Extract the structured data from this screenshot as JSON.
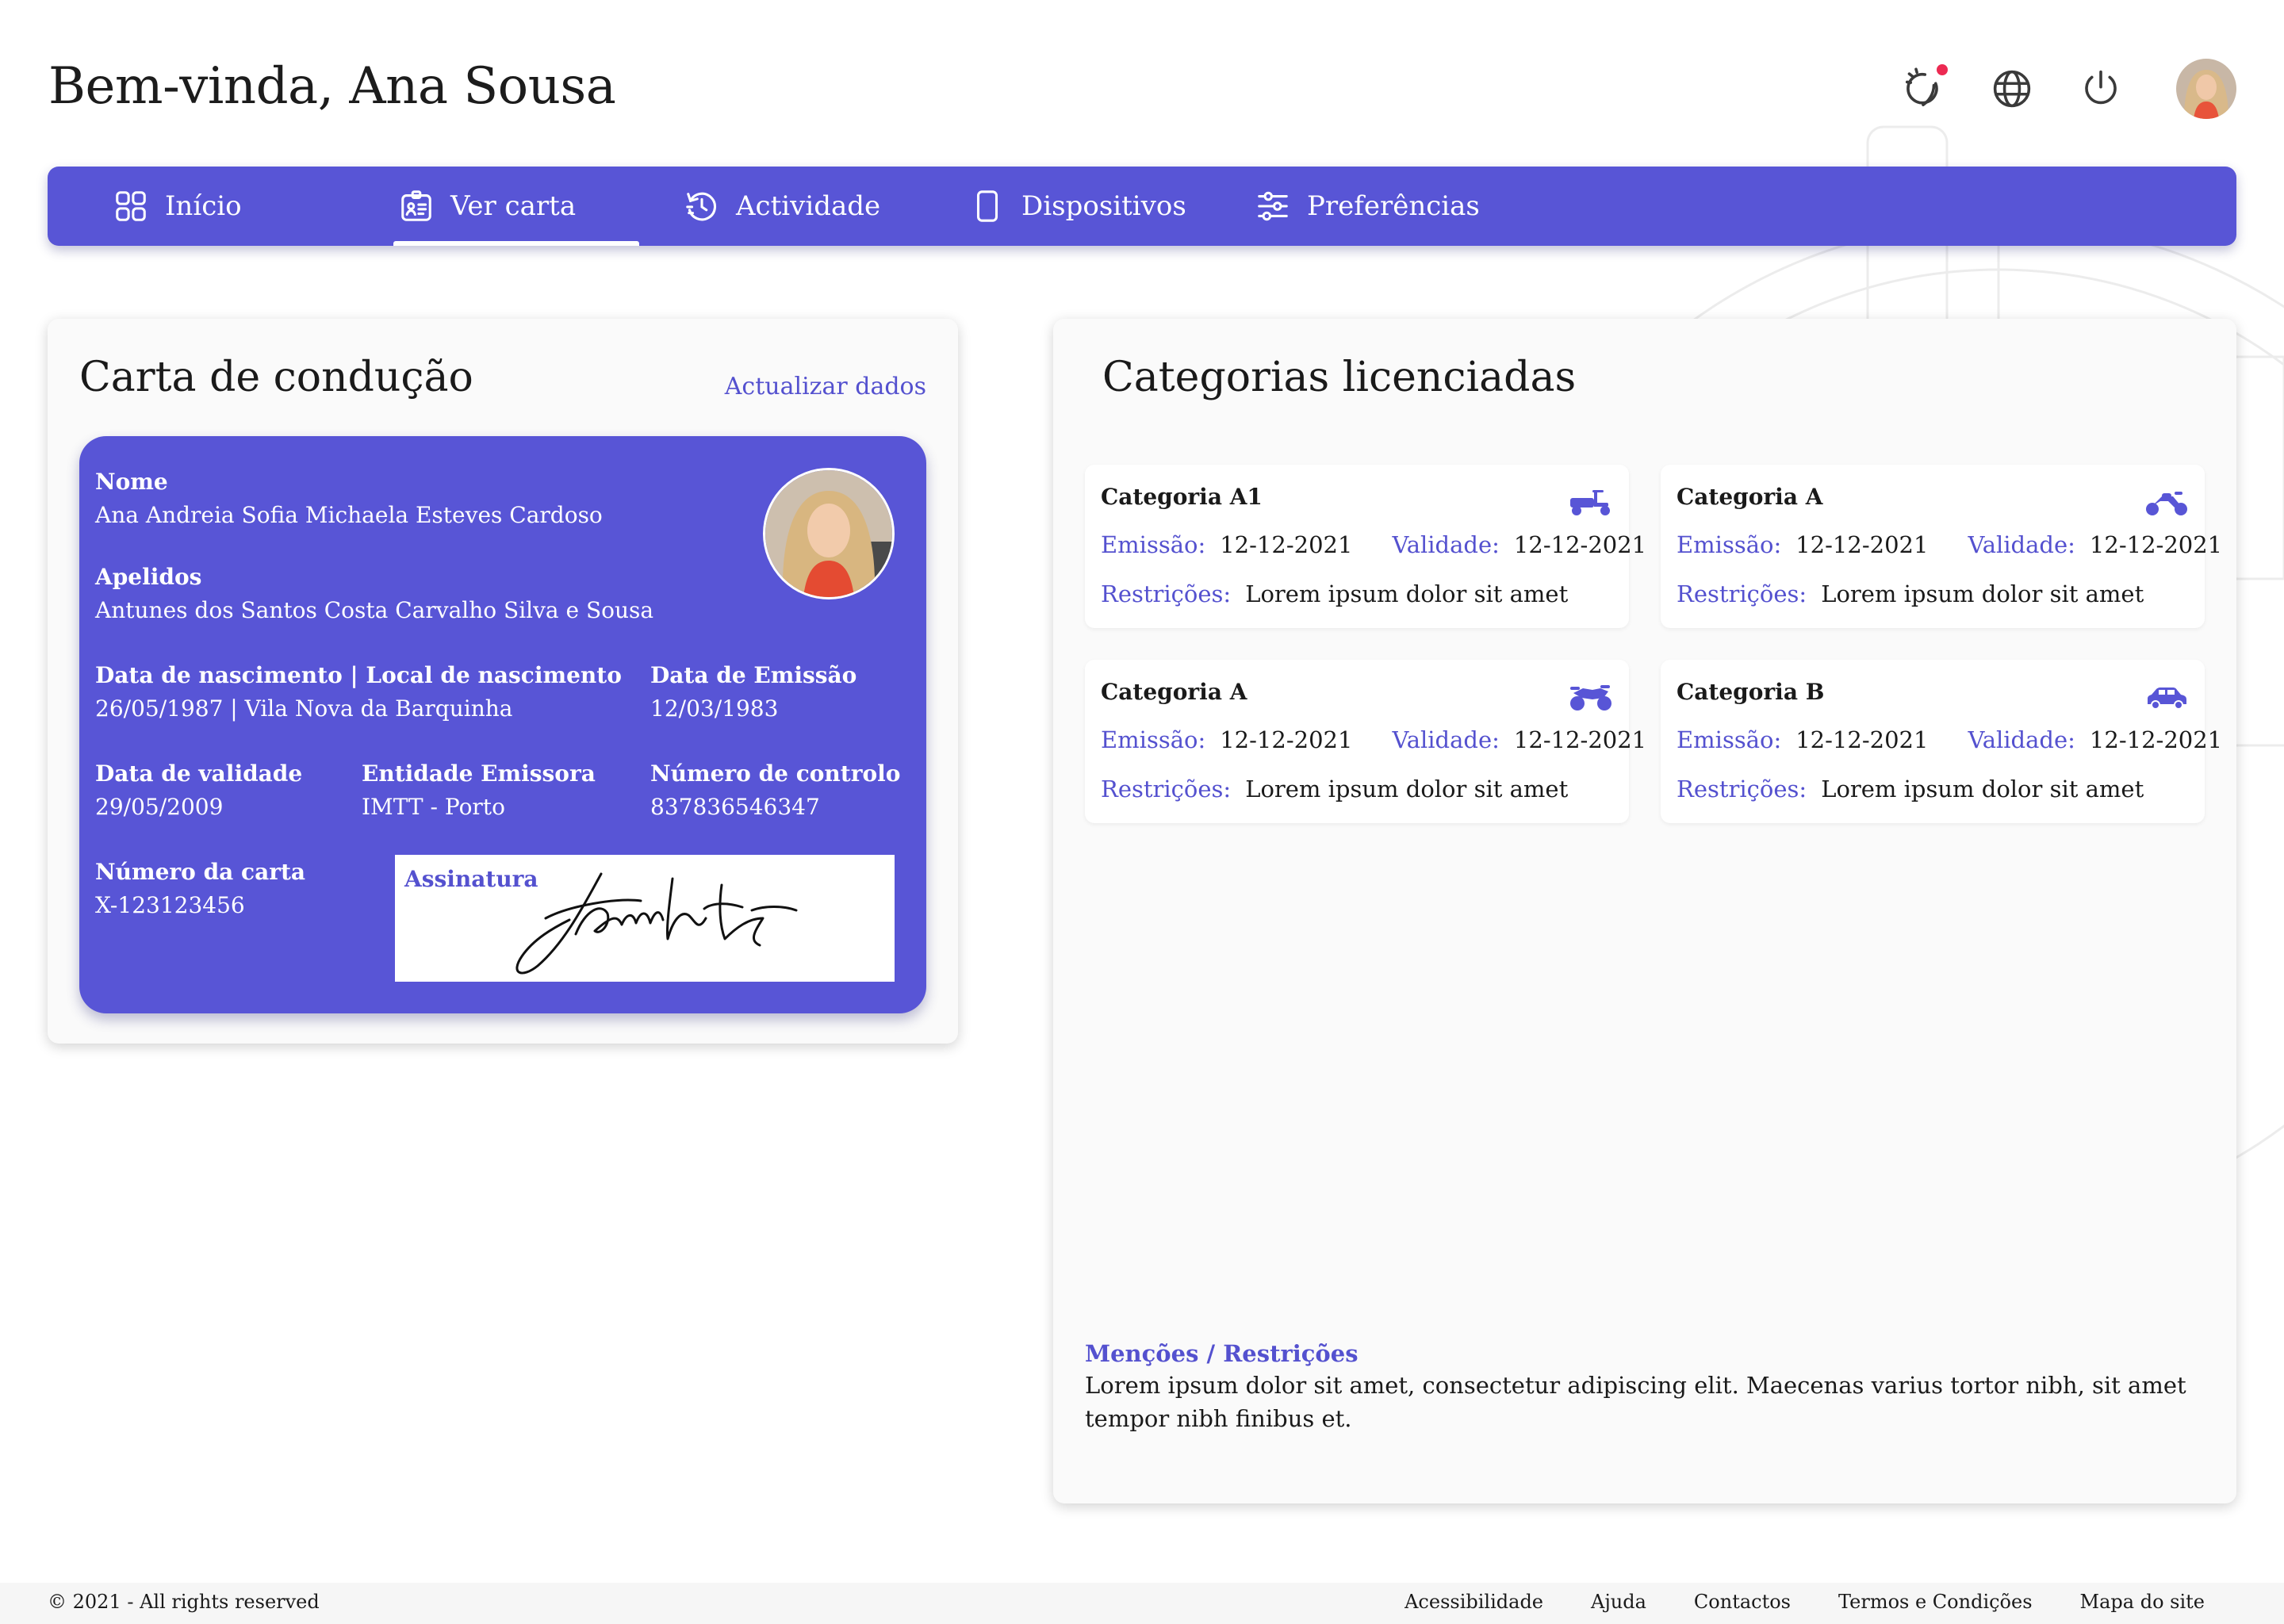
{
  "header": {
    "greeting": "Bem-vinda, Ana Sousa"
  },
  "top_icons": [
    "theme-icon",
    "globe-icon",
    "power-icon",
    "avatar"
  ],
  "nav": {
    "tabs": [
      {
        "label": "Início",
        "icon": "grid-icon",
        "active": false
      },
      {
        "label": "Ver carta",
        "icon": "id-card-icon",
        "active": true
      },
      {
        "label": "Actividade",
        "icon": "history-icon",
        "active": false
      },
      {
        "label": "Dispositivos",
        "icon": "phone-icon",
        "active": false
      },
      {
        "label": "Preferências",
        "icon": "sliders-icon",
        "active": false
      }
    ]
  },
  "license": {
    "title": "Carta de condução",
    "update_link": "Actualizar dados",
    "fields": {
      "nome": {
        "label": "Nome",
        "value": "Ana Andreia Sofia Michaela Esteves Cardoso"
      },
      "apelidos": {
        "label": "Apelidos",
        "value": "Antunes dos Santos Costa Carvalho Silva e Sousa"
      },
      "nascimento": {
        "label": "Data de nascimento | Local de nascimento",
        "value": "26/05/1987 | Vila Nova da Barquinha"
      },
      "emissao": {
        "label": "Data de Emissão",
        "value": "12/03/1983"
      },
      "validade": {
        "label": "Data de validade",
        "value": "29/05/2009"
      },
      "entidade": {
        "label": "Entidade Emissora",
        "value": "IMTT - Porto"
      },
      "controlo": {
        "label": "Número de controlo",
        "value": "837836546347"
      },
      "numero": {
        "label": "Número da carta",
        "value": "X-123123456"
      }
    },
    "signature_label": "Assinatura"
  },
  "categories": {
    "title": "Categorias licenciadas",
    "items": [
      {
        "name": "Categoria A1",
        "icon": "scooter-icon",
        "emissao_label": "Emissão:",
        "emissao": "12-12-2021",
        "validade_label": "Validade:",
        "validade": "12-12-2021",
        "restricoes_label": "Restrições:",
        "restricoes": "Lorem ipsum dolor sit amet"
      },
      {
        "name": "Categoria A",
        "icon": "motorcycle-icon",
        "emissao_label": "Emissão:",
        "emissao": "12-12-2021",
        "validade_label": "Validade:",
        "validade": "12-12-2021",
        "restricoes_label": "Restrições:",
        "restricoes": "Lorem ipsum dolor sit amet"
      },
      {
        "name": "Categoria A",
        "icon": "motorbike-icon",
        "emissao_label": "Emissão:",
        "emissao": "12-12-2021",
        "validade_label": "Validade:",
        "validade": "12-12-2021",
        "restricoes_label": "Restrições:",
        "restricoes": "Lorem ipsum dolor sit amet"
      },
      {
        "name": "Categoria B",
        "icon": "car-icon",
        "emissao_label": "Emissão:",
        "emissao": "12-12-2021",
        "validade_label": "Validade:",
        "validade": "12-12-2021",
        "restricoes_label": "Restrições:",
        "restricoes": "Lorem ipsum dolor sit amet"
      }
    ],
    "mentions_title": "Menções / Restrições",
    "mentions_text": "Lorem ipsum dolor sit amet, consectetur adipiscing elit. Maecenas varius tortor nibh, sit amet tempor nibh finibus et."
  },
  "footer": {
    "copyright": "© 2021 - All rights reserved",
    "links": [
      "Acessibilidade",
      "Ajuda",
      "Contactos",
      "Termos e Condições",
      "Mapa do site"
    ]
  },
  "colors": {
    "accent": "#5855d6",
    "link": "#5451cf",
    "notification": "#ec2a52",
    "background": "#ffffff",
    "panel": "#fafafa"
  }
}
